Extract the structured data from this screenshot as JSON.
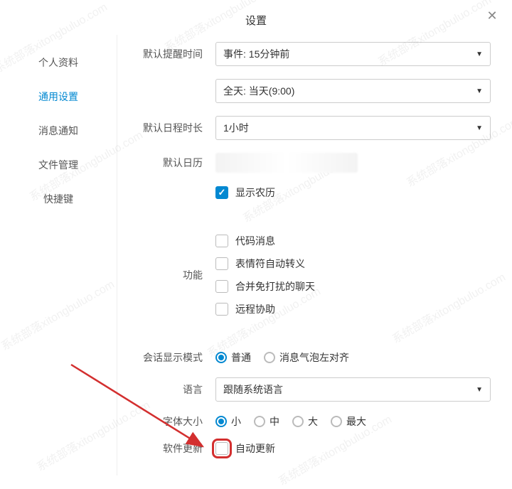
{
  "header": {
    "title": "设置"
  },
  "sidebar": {
    "items": [
      {
        "label": "个人资料"
      },
      {
        "label": "通用设置"
      },
      {
        "label": "消息通知"
      },
      {
        "label": "文件管理"
      },
      {
        "label": "快捷键"
      }
    ],
    "activeIndex": 1
  },
  "settings": {
    "reminder": {
      "label": "默认提醒时间",
      "event_value": "事件: 15分钟前",
      "allday_value": "全天: 当天(9:00)"
    },
    "duration": {
      "label": "默认日程时长",
      "value": "1小时"
    },
    "calendar": {
      "label": "默认日历"
    },
    "lunar": {
      "label": "显示农历",
      "checked": true
    },
    "features": {
      "label": "功能",
      "items": [
        {
          "label": "代码消息",
          "checked": false
        },
        {
          "label": "表情符自动转义",
          "checked": false
        },
        {
          "label": "合并免打扰的聊天",
          "checked": false
        },
        {
          "label": "远程协助",
          "checked": false
        }
      ]
    },
    "displayMode": {
      "label": "会话显示模式",
      "options": [
        {
          "label": "普通",
          "selected": true
        },
        {
          "label": "消息气泡左对齐",
          "selected": false
        }
      ]
    },
    "language": {
      "label": "语言",
      "value": "跟随系统语言"
    },
    "fontSize": {
      "label": "字体大小",
      "options": [
        {
          "label": "小",
          "selected": true
        },
        {
          "label": "中",
          "selected": false
        },
        {
          "label": "大",
          "selected": false
        },
        {
          "label": "最大",
          "selected": false
        }
      ]
    },
    "autoUpdate": {
      "label": "软件更新",
      "checkbox_label": "自动更新",
      "checked": false
    }
  },
  "watermark": "系统部落xitongbuluo.com",
  "colors": {
    "accent": "#0288d1",
    "highlight": "#d32f2f"
  }
}
